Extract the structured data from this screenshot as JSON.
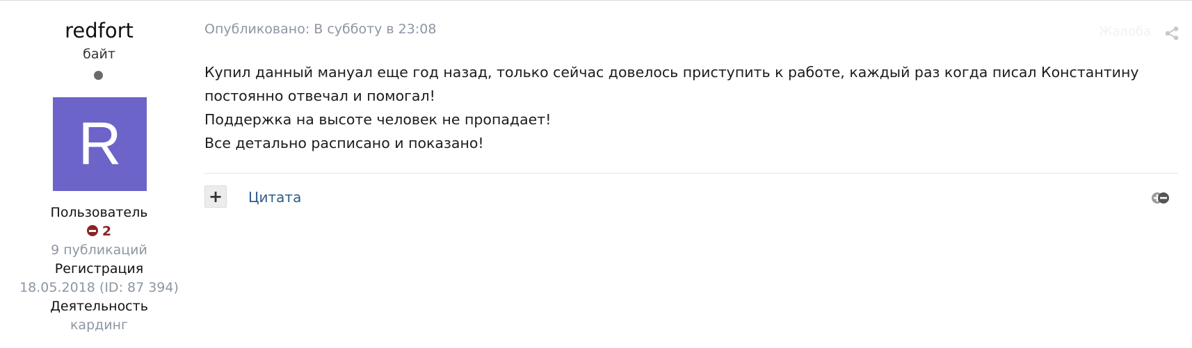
{
  "author": {
    "name": "redfort",
    "title": "байт",
    "avatar_letter": "R",
    "avatar_color": "#6c64c8",
    "group": "Пользователь",
    "reputation": "2",
    "reputation_color": "#8b2323",
    "posts": "9 публикаций",
    "registration_label": "Регистрация",
    "registration_value": "18.05.2018 (ID: 87 394)",
    "activity_label": "Деятельность",
    "activity_value": "кардинг"
  },
  "post": {
    "published": "Опубликовано: В субботу в 23:08",
    "report_label": "Жалоба",
    "body": [
      "Купил данный мануал еще год назад, только сейчас довелось приступить к работе, каждый раз когда писал Константину",
      "постоянно отвечал и помогал!",
      "Поддержка на высоте человек не пропадает!",
      "Все детально расписано и показано!"
    ],
    "plus_label": "+",
    "quote_label": "Цитата"
  },
  "icons": {
    "share": "share-icon",
    "multiquote": "multiquote-icon",
    "reputation": "minus-circle-icon",
    "status": "offline-dot-icon"
  }
}
